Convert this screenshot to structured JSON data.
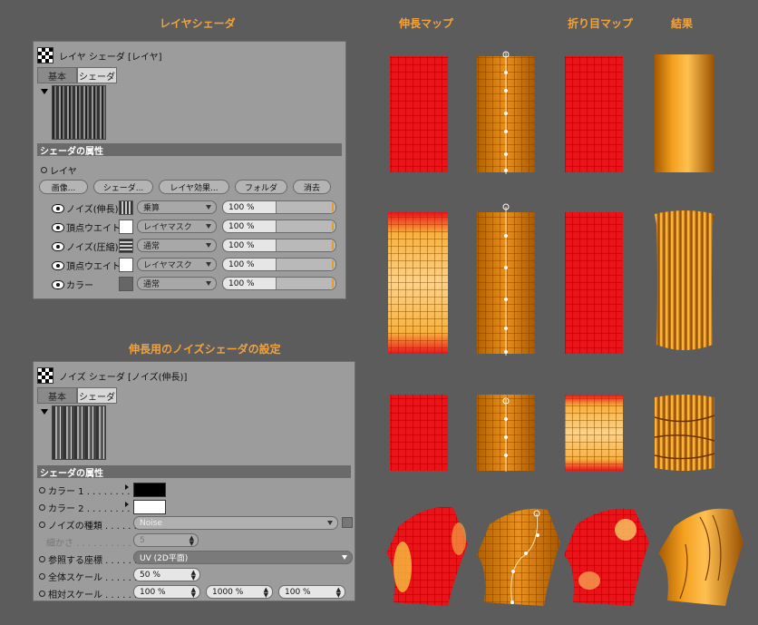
{
  "headings": {
    "layer_shader": "レイヤシェーダ",
    "stretch_map": "伸長マップ",
    "fold_map": "折り目マップ",
    "result": "結果",
    "noise_settings": "伸長用のノイズシェーダの設定"
  },
  "layer_panel": {
    "title": "レイヤ シェーダ [レイヤ]",
    "tabs": [
      "基本",
      "シェーダ"
    ],
    "active_tab": "シェーダ",
    "section": "シェーダの属性",
    "layer_label": "レイヤ",
    "buttons": [
      "画像...",
      "シェーダ...",
      "レイヤ効果...",
      "フォルダ",
      "消去"
    ],
    "layers": [
      {
        "name": "ノイズ(伸長)",
        "mode": "乗算",
        "value": "100 %"
      },
      {
        "name": "頂点ウエイト",
        "mode": "レイヤマスク",
        "value": "100 %"
      },
      {
        "name": "ノイズ(圧縮)",
        "mode": "通常",
        "value": "100 %"
      },
      {
        "name": "頂点ウエイト",
        "mode": "レイヤマスク",
        "value": "100 %"
      },
      {
        "name": "カラー",
        "mode": "通常",
        "value": "100 %"
      }
    ]
  },
  "noise_panel": {
    "title": "ノイズ シェーダ [ノイズ(伸長)]",
    "tabs": [
      "基本",
      "シェーダ"
    ],
    "active_tab": "シェーダ",
    "section": "シェーダの属性",
    "color1_label": "カラー 1 . . . . . . . .",
    "color2_label": "カラー 2 . . . . . . . .",
    "noise_type_label": "ノイズの種類 . . . . . .",
    "noise_type_value": "Noise",
    "octaves_label": "細かさ . . . . . . . . . .",
    "octaves_value": "5",
    "space_label": "参照する座標 . . . . . .",
    "space_value": "UV (2D平面)",
    "global_scale_label": "全体スケール . . . . . .",
    "global_scale_value": "50 %",
    "rel_scale_label": "相対スケール . . . . . .",
    "rel_scale_values": [
      "100 %",
      "1000 %",
      "100 %"
    ],
    "colors": {
      "color1": "#000000",
      "color2": "#ffffff"
    }
  },
  "colors": {
    "heading": "#f2a23c",
    "mesh_red": "#e8141a",
    "mesh_orange": "#e0820c",
    "panel": "#9c9c9c"
  }
}
